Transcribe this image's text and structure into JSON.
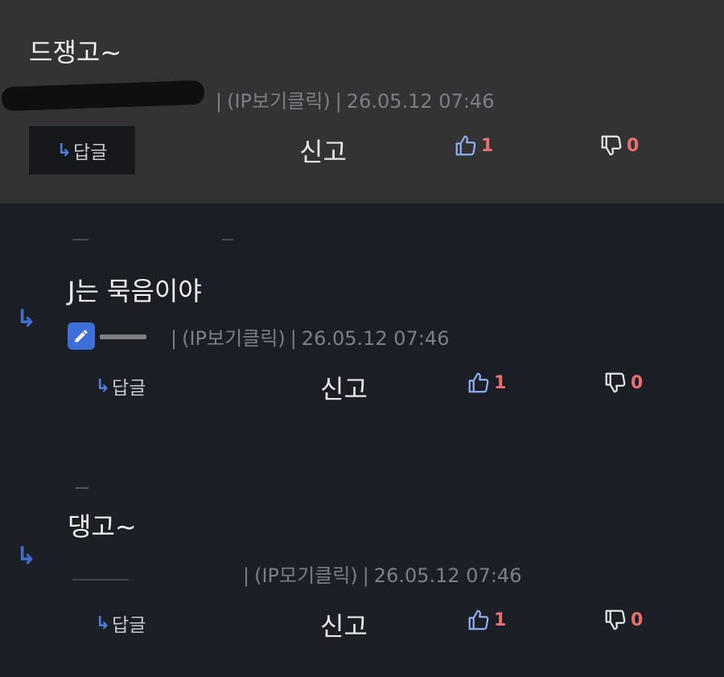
{
  "comments": [
    {
      "text": "드쟁고~",
      "meta": "(IP보기클릭)",
      "timestamp": "26.05.12 07:46",
      "reply_label": "답글",
      "report_label": "신고",
      "likes": "1",
      "dislikes": "0"
    },
    {
      "text": "J는 묵음이야",
      "meta": "(IP보기클릭)",
      "timestamp": "26.05.12 07:46",
      "reply_label": "답글",
      "report_label": "신고",
      "likes": "1",
      "dislikes": "0"
    },
    {
      "text": "댕고~",
      "meta": "(IP모기클릭)",
      "timestamp": "26.05.12 07:46",
      "reply_label": "답글",
      "report_label": "신고",
      "likes": "1",
      "dislikes": "0"
    }
  ],
  "colors": {
    "accent_blue": "#3f6fd1",
    "like_count": "#e87070",
    "bg_top": "#333333",
    "bg_dark": "#1c1f26"
  },
  "icons": {
    "reply": "reply-arrow-icon",
    "like": "thumbs-up-icon",
    "dislike": "thumbs-down-icon",
    "edit": "pencil-icon"
  }
}
